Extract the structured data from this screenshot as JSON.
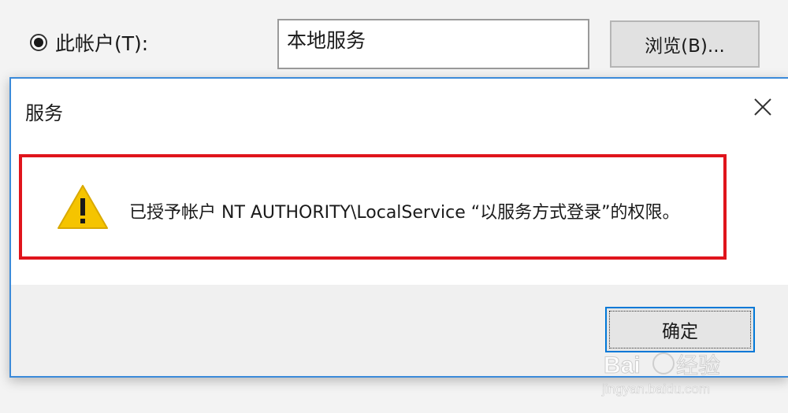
{
  "background": {
    "radio_label": "此帐户(T):",
    "account_value": "本地服务",
    "browse_label": "浏览(B)..."
  },
  "dialog": {
    "title": "服务",
    "message": "已授予帐户 NT AUTHORITY\\LocalService “以服务方式登录”的权限。",
    "ok_label": "确定",
    "close_icon": "close-icon",
    "warning_icon": "warning-icon"
  },
  "watermark": {
    "brand": "Baidu经验",
    "url": "jingyan.baidu.com"
  },
  "colors": {
    "highlight_border": "#e0141c",
    "dialog_border": "#3b8ad9",
    "focus_border": "#0078d7",
    "warning_fill": "#f5c400"
  }
}
